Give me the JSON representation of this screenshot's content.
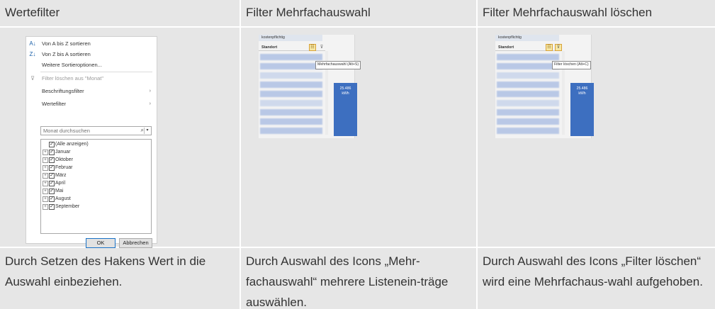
{
  "columns": [
    {
      "header": "Wertefilter",
      "description": "Durch Setzen des Hakens Wert in die Auswahl einbeziehen."
    },
    {
      "header": "Filter Mehrfachauswahl",
      "description": "Durch Auswahl des Icons „Mehr-fachauswahl“ mehrere Listenein-träge auswählen."
    },
    {
      "header": "Filter Mehrfachauswahl löschen",
      "description": "Durch Auswahl des Icons „Filter löschen“ wird eine Mehrfachaus-wahl aufgehoben."
    }
  ],
  "filter_dialog": {
    "sort_az": "Von A bis Z sortieren",
    "sort_za": "Von Z bis A sortieren",
    "more_sort": "Weitere Sortieroptionen...",
    "clear_filter": "Filter löschen aus \"Monat\"",
    "label_filter": "Beschriftungsfilter",
    "value_filter": "Wertefilter",
    "search_placeholder": "Monat durchsuchen",
    "items": [
      {
        "label": "(Alle anzeigen)",
        "checked": true,
        "expandable": false
      },
      {
        "label": "Januar",
        "checked": true,
        "expandable": true
      },
      {
        "label": "Oktober",
        "checked": true,
        "expandable": true
      },
      {
        "label": "Februar",
        "checked": true,
        "expandable": true
      },
      {
        "label": "März",
        "checked": true,
        "expandable": true
      },
      {
        "label": "April",
        "checked": true,
        "expandable": true
      },
      {
        "label": "Mai",
        "checked": true,
        "expandable": true
      },
      {
        "label": "August",
        "checked": true,
        "expandable": true
      },
      {
        "label": "September",
        "checked": true,
        "expandable": true
      }
    ],
    "ok": "OK",
    "cancel": "Abbrechen"
  },
  "slicer_multi": {
    "top_label": "kostenpflichtig",
    "header": "Standort",
    "tooltip": "Mehrfachauswahl (Alt+S)",
    "bar_value": "25.486",
    "bar_unit": "kWh"
  },
  "slicer_clear": {
    "top_label": "kostenpflichtig",
    "header": "Standort",
    "tooltip": "Filter löschen (Alt+C)",
    "bar_value": "25.486",
    "bar_unit": "kWh"
  },
  "colors": {
    "cell_bg": "#e6e6e6",
    "bar": "#3d6fc0",
    "highlight_button": "#f7e7a3"
  },
  "icons": [
    "sort-az-icon",
    "sort-za-icon",
    "clear-filter-icon",
    "search-icon",
    "multi-select-icon",
    "filter-clear-icon"
  ]
}
